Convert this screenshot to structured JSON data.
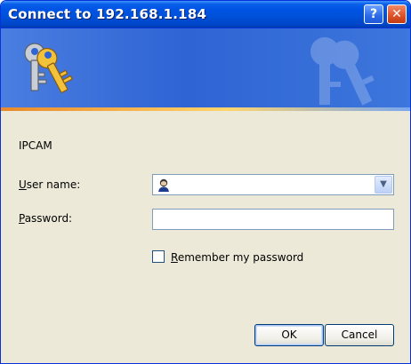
{
  "window": {
    "title": "Connect to 192.168.1.184",
    "help_label": "?",
    "close_label": "✕"
  },
  "icons": {
    "banner": "keys-icon",
    "user": "user-icon",
    "dropdown": "chevron-down-icon",
    "help": "help-icon",
    "close": "close-icon"
  },
  "colors": {
    "titlebar": "#0054e3",
    "banner": "#3a6fd8",
    "dialog_bg": "#ece9d8",
    "close": "#e0552b"
  },
  "form": {
    "realm": "IPCAM",
    "username_label": "User name:",
    "username_value": "",
    "password_label": "Password:",
    "password_value": "",
    "remember_label": "Remember my password",
    "remember_checked": false
  },
  "buttons": {
    "ok_label": "OK",
    "cancel_label": "Cancel"
  }
}
